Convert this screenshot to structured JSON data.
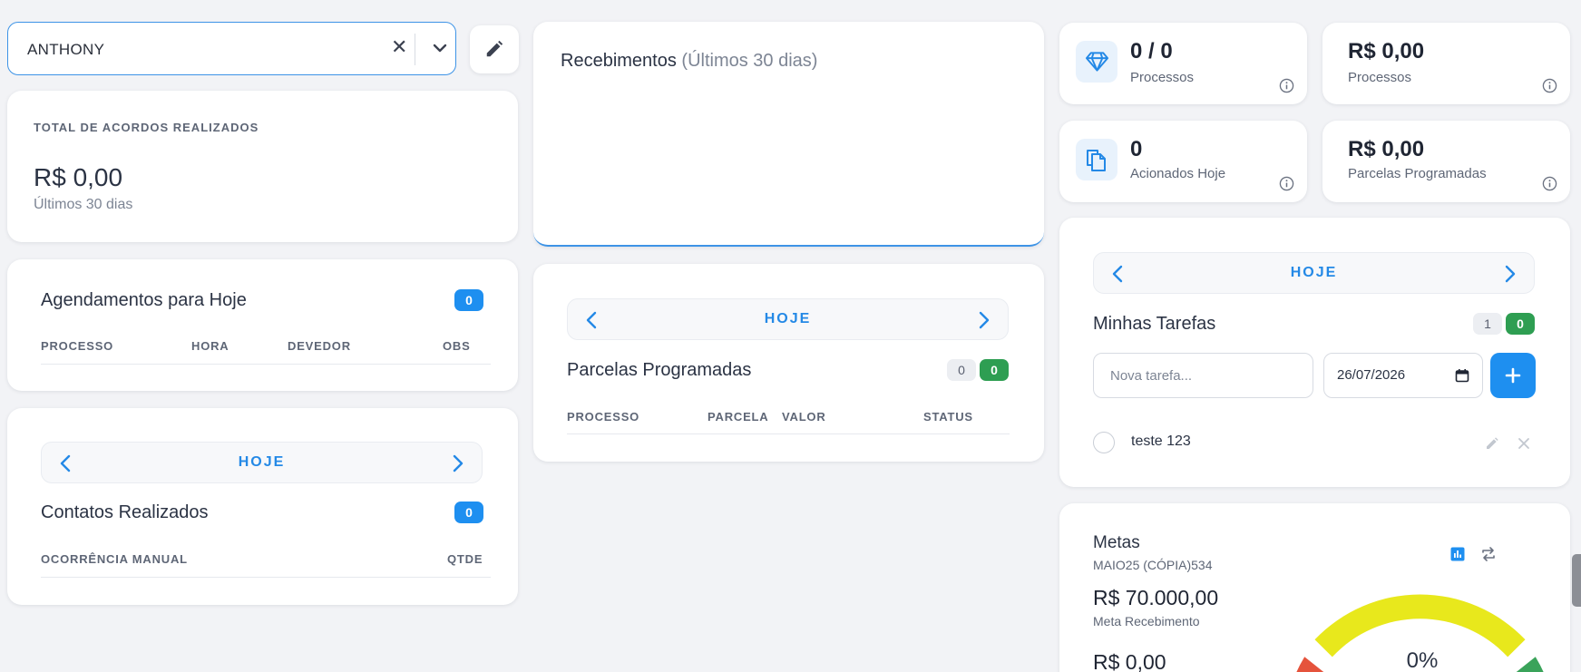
{
  "selector": {
    "value": "ANTHONY"
  },
  "acordos": {
    "heading": "TOTAL DE ACORDOS REALIZADOS",
    "value": "R$ 0,00",
    "sub": "Últimos 30 dias"
  },
  "agendamentos": {
    "title": "Agendamentos para Hoje",
    "badge": "0",
    "columns": [
      "PROCESSO",
      "HORA",
      "DEVEDOR",
      "OBS"
    ]
  },
  "contatos": {
    "nav_label": "HOJE",
    "title": "Contatos Realizados",
    "badge": "0",
    "columns": [
      "OCORRÊNCIA MANUAL",
      "QTDE"
    ]
  },
  "recebimentos": {
    "title": "Recebimentos",
    "subtitle": "(Últimos 30 dias)"
  },
  "parcelas": {
    "nav_label": "HOJE",
    "title": "Parcelas Programadas",
    "badge_gray": "0",
    "badge_green": "0",
    "columns": [
      "PROCESSO",
      "PARCELA",
      "VALOR",
      "STATUS"
    ]
  },
  "stats": [
    {
      "value": "0 / 0",
      "label": "Processos",
      "icon": "diamond-icon"
    },
    {
      "value": "R$ 0,00",
      "label": "Processos"
    },
    {
      "value": "0",
      "label": "Acionados Hoje",
      "icon": "copy-icon"
    },
    {
      "value": "R$ 0,00",
      "label": "Parcelas Programadas"
    }
  ],
  "tarefas": {
    "nav_label": "HOJE",
    "title": "Minhas Tarefas",
    "badge_gray": "1",
    "badge_green": "0",
    "input_placeholder": "Nova tarefa...",
    "date_value": "26/07/2026",
    "items": [
      {
        "text": "teste 123",
        "done": false
      }
    ]
  },
  "metas": {
    "title": "Metas",
    "subtitle": "MAIO25 (CÓPIA)534",
    "goal_value": "R$ 70.000,00",
    "goal_label": "Meta Recebimento",
    "current_value": "R$ 0,00",
    "gauge_percent": "0%",
    "gauge_value": 0
  },
  "colors": {
    "accent": "#1e8ff0",
    "green": "#2e9e52",
    "gauge_red": "#e5533c",
    "gauge_yellow": "#e8e81c",
    "gauge_green": "#3aa35a"
  }
}
